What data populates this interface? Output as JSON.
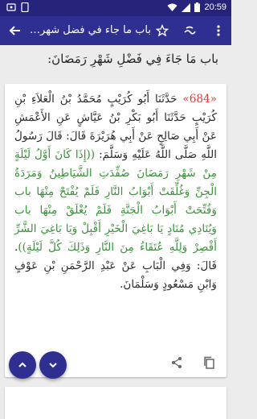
{
  "status": {
    "time": "20:59",
    "left_icons": [
      "notification-icon",
      "phone-icon"
    ],
    "right_icons": [
      "wifi-icon",
      "signal-icon",
      "battery-icon"
    ]
  },
  "toolbar": {
    "title": "باب ما جاء في فضل شهر ...",
    "icons": [
      "back-arrow-icon",
      "overflow-menu-icon",
      "font-size-icon",
      "star-icon"
    ]
  },
  "chapter": {
    "title": "باب مَا جَاءَ فِي فَضْلِ شَهْرِ رَمَضَانَ:"
  },
  "hadith": {
    "number": "«684»",
    "text_plain": " حَدَّثَنَا أَبُو كُرَيْبٍ مُحَمَّدُ بْنُ الْعَلاَءِ بْنِ كُرَيْبٍ حَدَّثَنَا أَبُو بَكْرِ بْنُ عَيَّاشٍ عَنِ الأَعْمَشِ عَنْ أَبِي صَالِحٍ عَنْ أَبِي هُرَيْرَةَ قَالَ: قَالَ رَسُولُ اللَّهِ صَلَّى اللَّهُ عَلَيْهِ وَسَلَّمَ: ",
    "text_green": "((إِذَا كَانَ أَوَّلُ لَيْلَةٍ مِنْ شَهْرِ رَمَضَانَ صُفِّدَتِ الشَّيَاطِينُ وَمَرَدَةُ الْجِنِّ وَغُلِّقَتْ أَبْوَابُ النَّارِ فَلَمْ يُفْتَحْ مِنْهَا باب وَفُتِّحَتْ أَبْوَابُ الْجَنَّةِ فَلَمْ يُغْلَقْ مِنْهَا باب وَيُنَادِي مُنَادٍ يَا بَاغِيَ الْخَيْرِ أَقْبِلْ وَيَا بَاغِيَ الشَّرِّ أَقْصِرْ وَلِلَّهِ عُتَقَاءُ مِنَ النَّارِ وَذَلِكَ كُلَّ لَيْلَةٍ))",
    "text_tail": ". قَالَ: وَفِي الْبَابِ عَنْ عَبْدِ الرَّحْمَنِ بْنِ عَوْفٍ وَابْنِ مَسْعُودٍ وَسَلْمَانَ."
  },
  "actions": [
    "share-icon",
    "copy-icon",
    "star-outline-icon"
  ],
  "fabs": [
    "arrow-up-icon",
    "arrow-down-icon"
  ],
  "colors": {
    "primary": "#2f2e91",
    "statusbar": "#26247a",
    "hadith_number": "#e53935",
    "prophet_quote": "#3b8f3b"
  }
}
